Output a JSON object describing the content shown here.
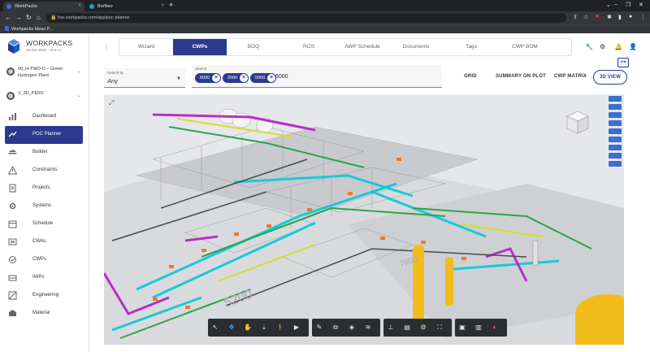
{
  "browser": {
    "tabs": [
      {
        "title": "WorkPacks",
        "active": true,
        "color": "#3b6fd9"
      },
      {
        "title": "BorNeo",
        "active": false,
        "color": "#1aa3c7"
      }
    ],
    "url": "live.workpacks.com/app/poc-planner",
    "bookmark": "Workpacks Ideas P..."
  },
  "app": {
    "brand": "WORKPACKS",
    "date": "15-Oct-2022 - v2.9.17",
    "project": "00_H-TWO-O – Green Hydrogen Plant",
    "scenario": "V_3D_PERS",
    "accent": "#2b3a8f"
  },
  "sidebar": {
    "items": [
      {
        "label": "Dashboard",
        "icon": "dashboard-icon",
        "active": false
      },
      {
        "label": "POC Planner",
        "icon": "poc-planner-icon",
        "active": true
      },
      {
        "label": "Builder",
        "icon": "builder-icon",
        "active": false
      },
      {
        "label": "Constraints",
        "icon": "constraints-icon",
        "active": false
      },
      {
        "label": "Projects",
        "icon": "projects-icon",
        "active": false
      },
      {
        "label": "Systems",
        "icon": "systems-icon",
        "active": false
      },
      {
        "label": "Schedule",
        "icon": "schedule-icon",
        "active": false
      },
      {
        "label": "CWAs",
        "icon": "cwas-icon",
        "active": false
      },
      {
        "label": "CWPs",
        "icon": "cwps-icon",
        "active": false
      },
      {
        "label": "IWPs",
        "icon": "iwps-icon",
        "active": false
      },
      {
        "label": "Engineering",
        "icon": "engineering-icon",
        "active": false
      },
      {
        "label": "Material",
        "icon": "material-icon",
        "active": false
      }
    ]
  },
  "tabs": [
    {
      "label": "Wizard",
      "active": false
    },
    {
      "label": "CWPs",
      "active": true
    },
    {
      "label": "BOQ",
      "active": false
    },
    {
      "label": "ROS",
      "active": false
    },
    {
      "label": "AWP Schedule",
      "active": false
    },
    {
      "label": "Documents",
      "active": false
    },
    {
      "label": "Tags",
      "active": false
    },
    {
      "label": "CWP BOM",
      "active": false
    }
  ],
  "search": {
    "by_label": "Search by",
    "by_value": "Any",
    "label": "Search",
    "chips": [
      "6000",
      "2000",
      "5000"
    ],
    "typed": "5000"
  },
  "view_buttons": [
    "GRID",
    "SUMMARY ON PLOT",
    "CWP MATRIX",
    "3D VIEW"
  ],
  "viewer": {
    "label_5200": "5200",
    "label_7600": "7600",
    "layers_count": 9,
    "toolbar_groups": [
      [
        "select-icon",
        "orbit-icon",
        "pan-icon",
        "lower-icon",
        "walk-icon",
        "camera-icon"
      ],
      [
        "measure-icon",
        "section-icon",
        "explode-icon",
        "layers-icon"
      ],
      [
        "tree-icon",
        "model-browser-icon",
        "settings-icon",
        "fullscreen-icon"
      ],
      [
        "docs-icon",
        "chart-icon",
        "color-icon"
      ]
    ]
  }
}
